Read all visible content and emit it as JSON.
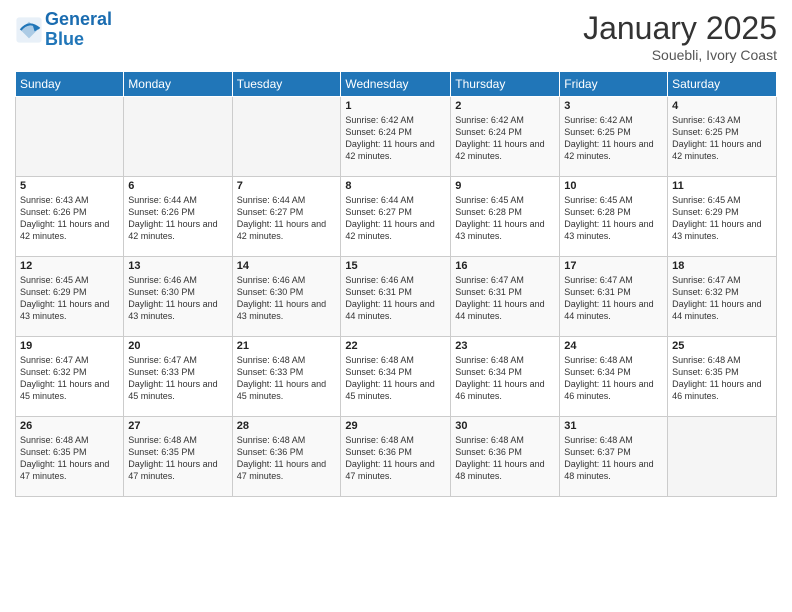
{
  "header": {
    "logo_line1": "General",
    "logo_line2": "Blue",
    "month": "January 2025",
    "location": "Souebli, Ivory Coast"
  },
  "days_of_week": [
    "Sunday",
    "Monday",
    "Tuesday",
    "Wednesday",
    "Thursday",
    "Friday",
    "Saturday"
  ],
  "weeks": [
    [
      {
        "day": "",
        "sunrise": "",
        "sunset": "",
        "daylight": ""
      },
      {
        "day": "",
        "sunrise": "",
        "sunset": "",
        "daylight": ""
      },
      {
        "day": "",
        "sunrise": "",
        "sunset": "",
        "daylight": ""
      },
      {
        "day": "1",
        "sunrise": "6:42 AM",
        "sunset": "6:24 PM",
        "daylight": "11 hours and 42 minutes."
      },
      {
        "day": "2",
        "sunrise": "6:42 AM",
        "sunset": "6:24 PM",
        "daylight": "11 hours and 42 minutes."
      },
      {
        "day": "3",
        "sunrise": "6:42 AM",
        "sunset": "6:25 PM",
        "daylight": "11 hours and 42 minutes."
      },
      {
        "day": "4",
        "sunrise": "6:43 AM",
        "sunset": "6:25 PM",
        "daylight": "11 hours and 42 minutes."
      }
    ],
    [
      {
        "day": "5",
        "sunrise": "6:43 AM",
        "sunset": "6:26 PM",
        "daylight": "11 hours and 42 minutes."
      },
      {
        "day": "6",
        "sunrise": "6:44 AM",
        "sunset": "6:26 PM",
        "daylight": "11 hours and 42 minutes."
      },
      {
        "day": "7",
        "sunrise": "6:44 AM",
        "sunset": "6:27 PM",
        "daylight": "11 hours and 42 minutes."
      },
      {
        "day": "8",
        "sunrise": "6:44 AM",
        "sunset": "6:27 PM",
        "daylight": "11 hours and 42 minutes."
      },
      {
        "day": "9",
        "sunrise": "6:45 AM",
        "sunset": "6:28 PM",
        "daylight": "11 hours and 43 minutes."
      },
      {
        "day": "10",
        "sunrise": "6:45 AM",
        "sunset": "6:28 PM",
        "daylight": "11 hours and 43 minutes."
      },
      {
        "day": "11",
        "sunrise": "6:45 AM",
        "sunset": "6:29 PM",
        "daylight": "11 hours and 43 minutes."
      }
    ],
    [
      {
        "day": "12",
        "sunrise": "6:45 AM",
        "sunset": "6:29 PM",
        "daylight": "11 hours and 43 minutes."
      },
      {
        "day": "13",
        "sunrise": "6:46 AM",
        "sunset": "6:30 PM",
        "daylight": "11 hours and 43 minutes."
      },
      {
        "day": "14",
        "sunrise": "6:46 AM",
        "sunset": "6:30 PM",
        "daylight": "11 hours and 43 minutes."
      },
      {
        "day": "15",
        "sunrise": "6:46 AM",
        "sunset": "6:31 PM",
        "daylight": "11 hours and 44 minutes."
      },
      {
        "day": "16",
        "sunrise": "6:47 AM",
        "sunset": "6:31 PM",
        "daylight": "11 hours and 44 minutes."
      },
      {
        "day": "17",
        "sunrise": "6:47 AM",
        "sunset": "6:31 PM",
        "daylight": "11 hours and 44 minutes."
      },
      {
        "day": "18",
        "sunrise": "6:47 AM",
        "sunset": "6:32 PM",
        "daylight": "11 hours and 44 minutes."
      }
    ],
    [
      {
        "day": "19",
        "sunrise": "6:47 AM",
        "sunset": "6:32 PM",
        "daylight": "11 hours and 45 minutes."
      },
      {
        "day": "20",
        "sunrise": "6:47 AM",
        "sunset": "6:33 PM",
        "daylight": "11 hours and 45 minutes."
      },
      {
        "day": "21",
        "sunrise": "6:48 AM",
        "sunset": "6:33 PM",
        "daylight": "11 hours and 45 minutes."
      },
      {
        "day": "22",
        "sunrise": "6:48 AM",
        "sunset": "6:34 PM",
        "daylight": "11 hours and 45 minutes."
      },
      {
        "day": "23",
        "sunrise": "6:48 AM",
        "sunset": "6:34 PM",
        "daylight": "11 hours and 46 minutes."
      },
      {
        "day": "24",
        "sunrise": "6:48 AM",
        "sunset": "6:34 PM",
        "daylight": "11 hours and 46 minutes."
      },
      {
        "day": "25",
        "sunrise": "6:48 AM",
        "sunset": "6:35 PM",
        "daylight": "11 hours and 46 minutes."
      }
    ],
    [
      {
        "day": "26",
        "sunrise": "6:48 AM",
        "sunset": "6:35 PM",
        "daylight": "11 hours and 47 minutes."
      },
      {
        "day": "27",
        "sunrise": "6:48 AM",
        "sunset": "6:35 PM",
        "daylight": "11 hours and 47 minutes."
      },
      {
        "day": "28",
        "sunrise": "6:48 AM",
        "sunset": "6:36 PM",
        "daylight": "11 hours and 47 minutes."
      },
      {
        "day": "29",
        "sunrise": "6:48 AM",
        "sunset": "6:36 PM",
        "daylight": "11 hours and 47 minutes."
      },
      {
        "day": "30",
        "sunrise": "6:48 AM",
        "sunset": "6:36 PM",
        "daylight": "11 hours and 48 minutes."
      },
      {
        "day": "31",
        "sunrise": "6:48 AM",
        "sunset": "6:37 PM",
        "daylight": "11 hours and 48 minutes."
      },
      {
        "day": "",
        "sunrise": "",
        "sunset": "",
        "daylight": ""
      }
    ]
  ],
  "labels": {
    "sunrise": "Sunrise:",
    "sunset": "Sunset:",
    "daylight": "Daylight:"
  }
}
